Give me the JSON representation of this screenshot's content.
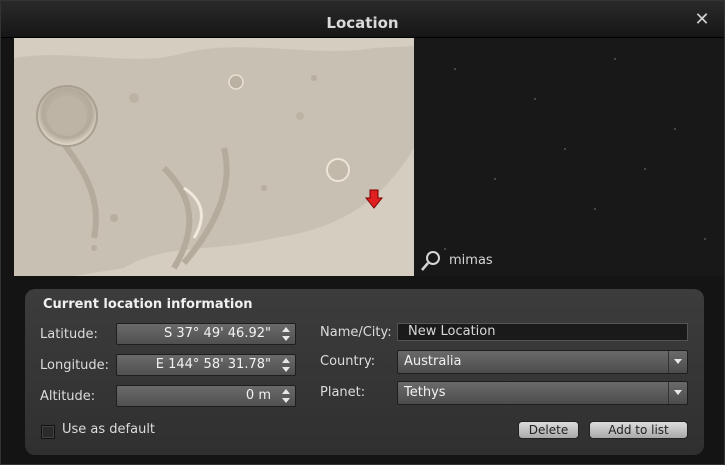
{
  "window": {
    "title": "Location"
  },
  "search": {
    "value": "mimas"
  },
  "panel": {
    "title": "Current location information",
    "latitude": {
      "label": "Latitude:",
      "value": "S 37° 49' 46.92\""
    },
    "longitude": {
      "label": "Longitude:",
      "value": "E 144° 58' 31.78\""
    },
    "altitude": {
      "label": "Altitude:",
      "value": "0 m"
    },
    "name": {
      "label": "Name/City:",
      "value": "New Location"
    },
    "country": {
      "label": "Country:",
      "value": "Australia"
    },
    "planet": {
      "label": "Planet:",
      "value": "Tethys"
    },
    "use_default": {
      "label": "Use as default",
      "checked": false
    },
    "delete_label": "Delete",
    "add_label": "Add to list"
  },
  "colors": {
    "marker": "#e02020",
    "panel": "#353535"
  },
  "icons": {
    "close": "close-icon",
    "search": "search-icon",
    "marker": "location-marker-icon"
  }
}
